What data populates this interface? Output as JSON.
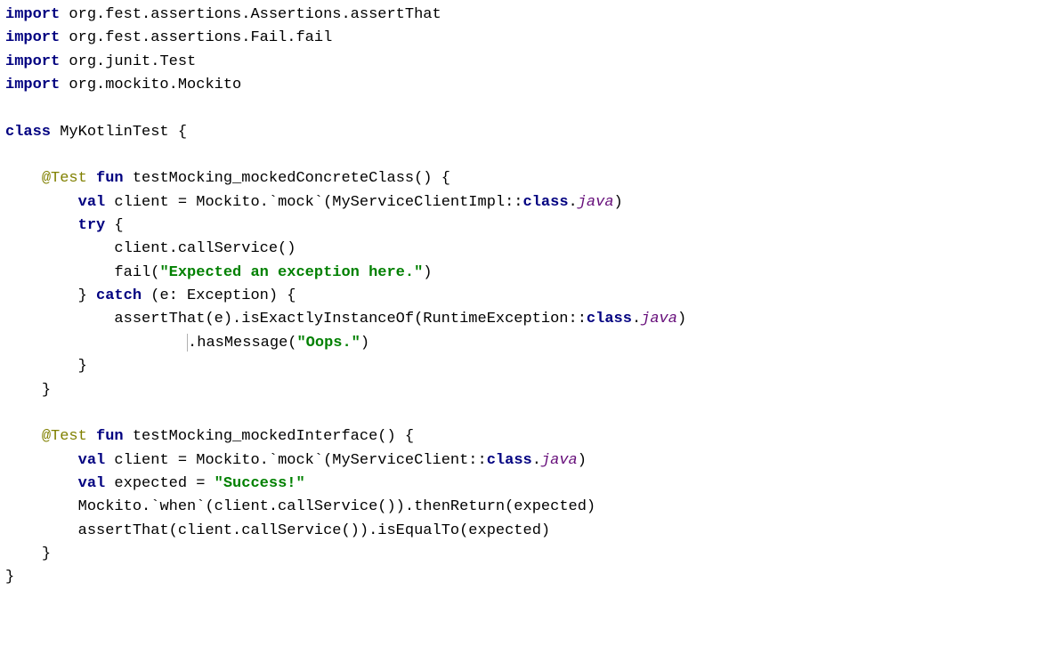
{
  "code": {
    "l1_kw": "import",
    "l1_pkg": " org.fest.assertions.Assertions.assertThat",
    "l2_kw": "import",
    "l2_pkg": " org.fest.assertions.Fail.fail",
    "l3_kw": "import",
    "l3_pkg1": " org.junit.",
    "l3_cls": "Test",
    "l4_kw": "import",
    "l4_pkg": " org.mockito.Mockito",
    "l6_kw": "class",
    "l6_name": " MyKotlinTest {",
    "l8_indent": "    ",
    "l8_anno": "@Test",
    "l8_kw": " fun",
    "l8_rest": " testMocking_mockedConcreteClass() {",
    "l9_indent": "        ",
    "l9_kw": "val",
    "l9_rest1": " client = Mockito.`mock`(MyServiceClientImpl::",
    "l9_kw2": "class",
    "l9_dot": ".",
    "l9_java": "java",
    "l9_close": ")",
    "l10_indent": "        ",
    "l10_kw": "try",
    "l10_rest": " {",
    "l11_indent": "            ",
    "l11_rest": "client.callService()",
    "l12_indent": "            ",
    "l12_rest1": "fail(",
    "l12_str": "\"Expected an exception here.\"",
    "l12_rest2": ")",
    "l13_indent": "        ",
    "l13_rest1": "} ",
    "l13_kw": "catch",
    "l13_rest2": " (e: Exception) {",
    "l14_indent": "            ",
    "l14_rest1": "assertThat(e).isExactlyInstanceOf(RuntimeException::",
    "l14_kw": "class",
    "l14_dot": ".",
    "l14_java": "java",
    "l14_close": ")",
    "l15_indent": "                    ",
    "l15_rest1": ".hasMessage(",
    "l15_str": "\"Oops.\"",
    "l15_rest2": ")",
    "l16_indent": "        ",
    "l16_rest": "}",
    "l17_indent": "    ",
    "l17_rest": "}",
    "l19_indent": "    ",
    "l19_anno": "@Test",
    "l19_kw": " fun",
    "l19_rest": " testMocking_mockedInterface() {",
    "l20_indent": "        ",
    "l20_kw": "val",
    "l20_rest1": " client = Mockito.`mock`(MyServiceClient::",
    "l20_kw2": "class",
    "l20_dot": ".",
    "l20_java": "java",
    "l20_close": ")",
    "l21_indent": "        ",
    "l21_kw": "val",
    "l21_rest1": " expected = ",
    "l21_str": "\"Success!\"",
    "l22_indent": "        ",
    "l22_rest": "Mockito.`when`(client.callService()).thenReturn(expected)",
    "l23_indent": "        ",
    "l23_rest": "assertThat(client.callService()).isEqualTo(expected)",
    "l24_indent": "    ",
    "l24_rest": "}",
    "l25_rest": "}"
  }
}
